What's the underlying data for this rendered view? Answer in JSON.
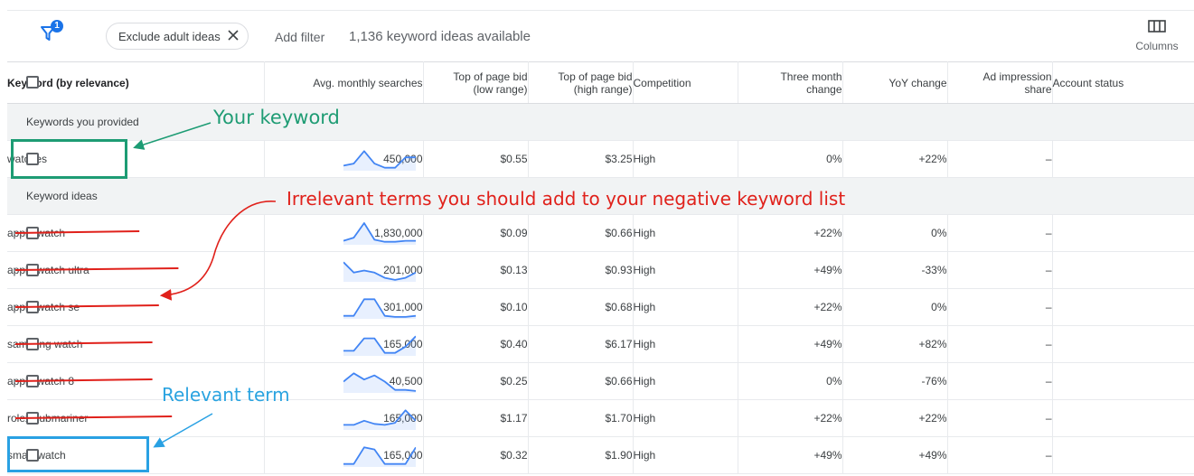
{
  "toolbar": {
    "filter_badge": "1",
    "chip_label": "Exclude adult ideas",
    "add_filter": "Add filter",
    "ideas_count": "1,136 keyword ideas available",
    "columns_label": "Columns"
  },
  "table": {
    "headers": {
      "keyword": "Keyword (by relevance)",
      "avg": "Avg. monthly searches",
      "low_bid": [
        "Top of page bid",
        "(low range)"
      ],
      "high_bid": [
        "Top of page bid",
        "(high range)"
      ],
      "competition": "Competition",
      "three_month": [
        "Three month",
        "change"
      ],
      "yoy": "YoY change",
      "impression": [
        "Ad impression",
        "share"
      ],
      "account": "Account status"
    },
    "section_provided": "Keywords you provided",
    "section_ideas": "Keyword ideas",
    "provided": [
      {
        "keyword": "watches",
        "searches": "450,000",
        "trend": [
          0.2,
          0.3,
          0.9,
          0.3,
          0.1,
          0.1,
          0.6,
          0.6
        ],
        "low": "$0.55",
        "high": "$3.25",
        "competition": "High",
        "three_month": "0%",
        "yoy": "+22%",
        "impression": "–",
        "account": "",
        "struck": false
      }
    ],
    "ideas": [
      {
        "keyword": "apple watch",
        "searches": "1,830,000",
        "trend": [
          0.15,
          0.3,
          1.0,
          0.2,
          0.1,
          0.1,
          0.15,
          0.15
        ],
        "low": "$0.09",
        "high": "$0.66",
        "competition": "High",
        "three_month": "+22%",
        "yoy": "0%",
        "impression": "–",
        "account": "",
        "struck": true
      },
      {
        "keyword": "apple watch ultra",
        "searches": "201,000",
        "trend": [
          0.9,
          0.4,
          0.5,
          0.4,
          0.15,
          0.05,
          0.15,
          0.4
        ],
        "low": "$0.13",
        "high": "$0.93",
        "competition": "High",
        "three_month": "+49%",
        "yoy": "-33%",
        "impression": "–",
        "account": "",
        "struck": true
      },
      {
        "keyword": "apple watch se",
        "searches": "301,000",
        "trend": [
          0.1,
          0.1,
          0.9,
          0.9,
          0.1,
          0.05,
          0.05,
          0.1
        ],
        "low": "$0.10",
        "high": "$0.68",
        "competition": "High",
        "three_month": "+22%",
        "yoy": "0%",
        "impression": "–",
        "account": "",
        "struck": true
      },
      {
        "keyword": "samsung watch",
        "searches": "165,000",
        "trend": [
          0.2,
          0.2,
          0.8,
          0.8,
          0.1,
          0.1,
          0.4,
          0.9
        ],
        "low": "$0.40",
        "high": "$6.17",
        "competition": "High",
        "three_month": "+49%",
        "yoy": "+82%",
        "impression": "–",
        "account": "",
        "struck": true
      },
      {
        "keyword": "apple watch 8",
        "searches": "40,500",
        "trend": [
          0.5,
          0.9,
          0.6,
          0.8,
          0.5,
          0.1,
          0.1,
          0.05
        ],
        "low": "$0.25",
        "high": "$0.66",
        "competition": "High",
        "three_month": "0%",
        "yoy": "-76%",
        "impression": "–",
        "account": "",
        "struck": true
      },
      {
        "keyword": "rolex submariner",
        "searches": "165,000",
        "trend": [
          0.2,
          0.2,
          0.4,
          0.25,
          0.2,
          0.3,
          0.9,
          0.4
        ],
        "low": "$1.17",
        "high": "$1.70",
        "competition": "High",
        "three_month": "+22%",
        "yoy": "+22%",
        "impression": "–",
        "account": "",
        "struck": true
      },
      {
        "keyword": "smart watch",
        "searches": "165,000",
        "trend": [
          0.1,
          0.1,
          0.9,
          0.8,
          0.1,
          0.1,
          0.1,
          0.9
        ],
        "low": "$0.32",
        "high": "$1.90",
        "competition": "High",
        "three_month": "+49%",
        "yoy": "+49%",
        "impression": "–",
        "account": "",
        "struck": false
      }
    ]
  },
  "annotations": {
    "your_keyword": "Your keyword",
    "irrelevant": "Irrelevant terms you should add to your negative keyword list",
    "relevant": "Relevant term"
  },
  "colors": {
    "accent": "#1a73e8",
    "spark": "#4285f4",
    "green_note": "#1d9c74",
    "red_note": "#e0211b",
    "blue_note": "#29a1e3"
  }
}
